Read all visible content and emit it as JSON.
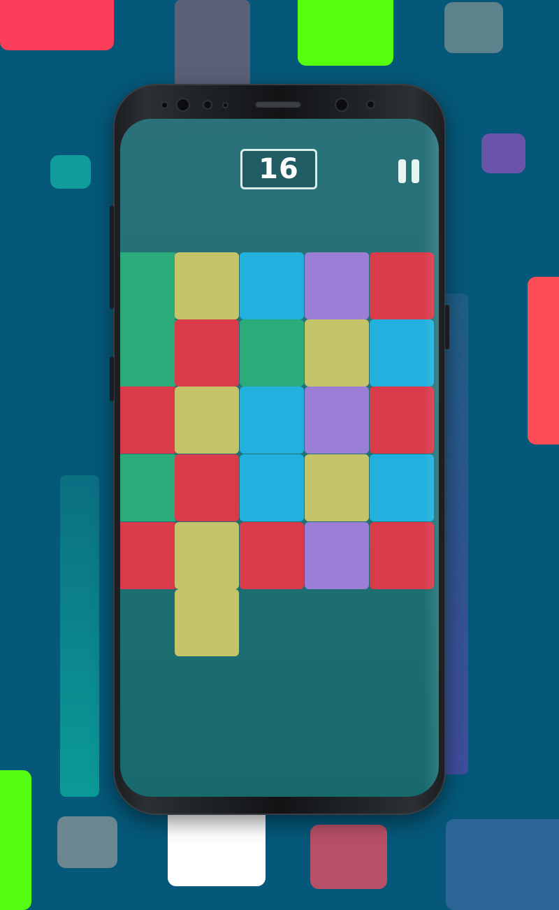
{
  "game": {
    "score": "16",
    "pause_icon": "pause-icon"
  },
  "colors": {
    "green": "#2bab79",
    "yellow": "#c6c46a",
    "blue": "#22b1df",
    "purple": "#9b7fd6",
    "red": "#d93b4b",
    "background": "#05587a",
    "screen": "#207178"
  },
  "board": {
    "rows": [
      [
        "green",
        "yellow",
        "blue",
        "purple",
        "red"
      ],
      [
        "green",
        "red",
        "green",
        "yellow",
        "blue"
      ],
      [
        "red",
        "yellow",
        "blue",
        "purple",
        "red"
      ],
      [
        "green",
        "red",
        "blue",
        "yellow",
        "blue"
      ],
      [
        "red",
        "yellow",
        "red",
        "purple",
        "red"
      ],
      [
        null,
        "yellow",
        null,
        null,
        null
      ]
    ]
  }
}
